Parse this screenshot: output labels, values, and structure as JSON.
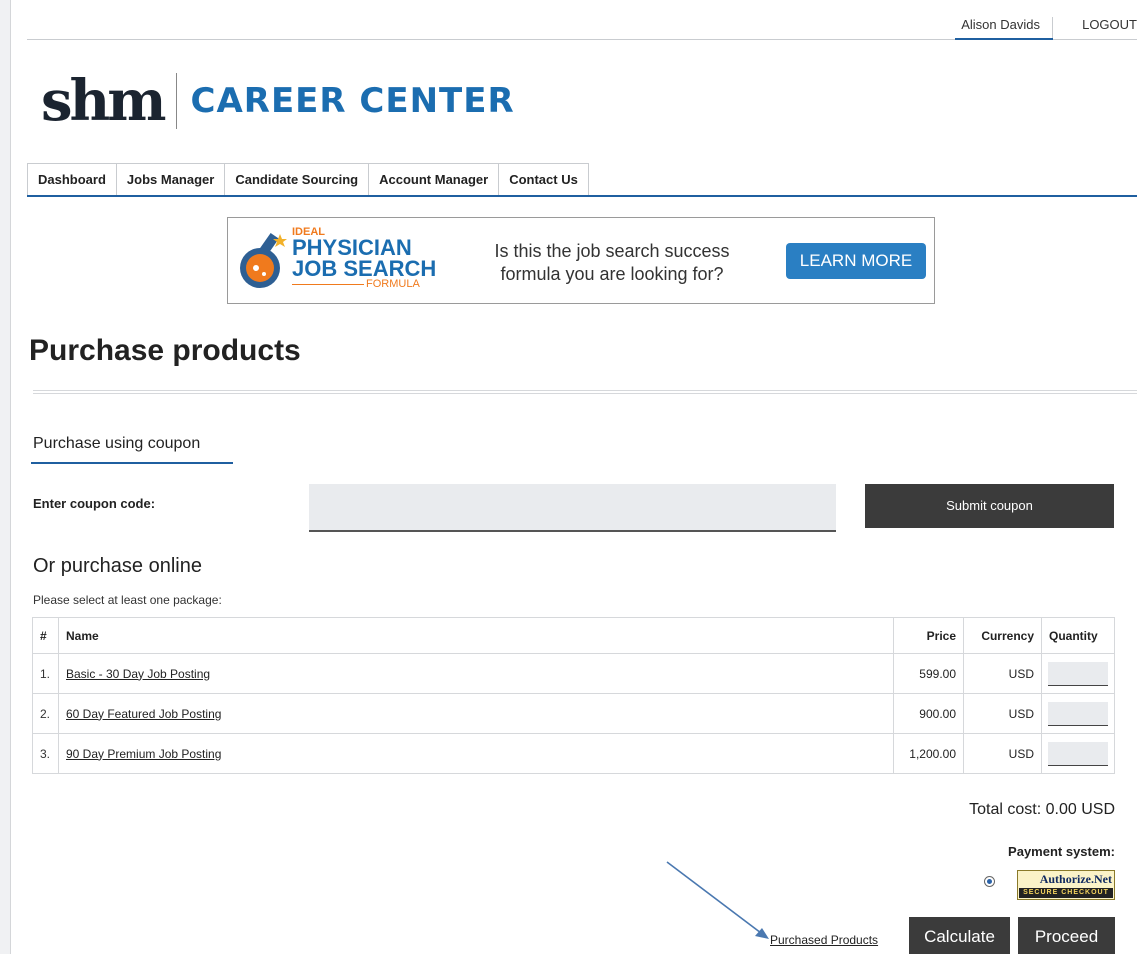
{
  "user": {
    "name": "Alison Davids",
    "logout": "LOGOUT"
  },
  "logo": {
    "mark": "shm",
    "text": "CAREER CENTER"
  },
  "nav": [
    "Dashboard",
    "Jobs Manager",
    "Candidate Sourcing",
    "Account Manager",
    "Contact Us"
  ],
  "banner": {
    "line1": "IDEAL",
    "line2": "PHYSICIAN",
    "line3": "JOB SEARCH",
    "line4": "FORMULA",
    "tagline": "Is this the job search success formula you are looking for?",
    "button": "LEARN MORE"
  },
  "page_title": "Purchase products",
  "coupon": {
    "tab": "Purchase using coupon",
    "label": "Enter coupon code:",
    "value": "",
    "button": "Submit coupon"
  },
  "online": {
    "title": "Or purchase online",
    "subtitle": "Please select at least one package:",
    "headers": {
      "num": "#",
      "name": "Name",
      "price": "Price",
      "currency": "Currency",
      "quantity": "Quantity"
    },
    "rows": [
      {
        "num": "1.",
        "name": "Basic - 30 Day Job Posting",
        "price": "599.00",
        "currency": "USD",
        "quantity": ""
      },
      {
        "num": "2.",
        "name": "60 Day Featured Job Posting",
        "price": "900.00",
        "currency": "USD",
        "quantity": ""
      },
      {
        "num": "3.",
        "name": "90 Day Premium Job Posting",
        "price": "1,200.00",
        "currency": "USD",
        "quantity": ""
      }
    ]
  },
  "total": "Total cost: 0.00 USD",
  "payment": {
    "label": "Payment system:",
    "provider": "Authorize.Net",
    "provider_badge": "SECURE CHECKOUT"
  },
  "footer": {
    "purchased_link": "Purchased Products",
    "calculate": "Calculate",
    "proceed": "Proceed"
  },
  "colors": {
    "brand_blue": "#1f5fa0",
    "button_dark": "#3b3b3b",
    "banner_blue": "#2a7fc3",
    "banner_orange": "#f07a1d"
  }
}
